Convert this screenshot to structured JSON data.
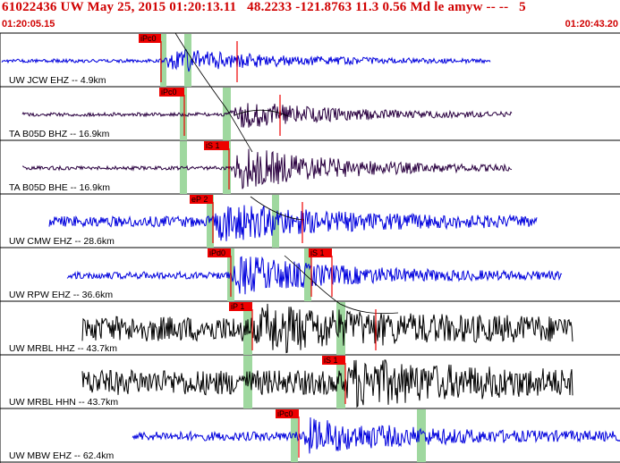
{
  "header": {
    "title": "61022436 UW May 25, 2015 01:20:13.11   48.2233 -121.8763 11.3 0.56 Md le amyw -- --   5",
    "start_time": "01:20:05.15",
    "end_time": "01:20:43.20"
  },
  "colors": {
    "header_text": "#d00000",
    "pick_box": "#ee0000",
    "window_shade": "#9fd89f",
    "trace_blue": "#0000dd",
    "trace_purple": "#2a0040",
    "trace_black": "#000000",
    "travel_time_curve": "#000000"
  },
  "traces": [
    {
      "label": "UW JCW EHZ -- 4.9km",
      "color": "trace_blue",
      "picks": [
        {
          "label": "iPc0"
        }
      ],
      "shades": 2
    },
    {
      "label": "TA B05D BHZ -- 16.9km",
      "color": "trace_purple",
      "picks": [
        {
          "label": "iPc0"
        }
      ],
      "shades": 2
    },
    {
      "label": "TA B05D BHE -- 16.9km",
      "color": "trace_purple",
      "picks": [
        {
          "label": "iS 1"
        }
      ],
      "shades": 2
    },
    {
      "label": "UW CMW EHZ -- 28.6km",
      "color": "trace_blue",
      "picks": [
        {
          "label": "eP 2"
        }
      ],
      "shades": 2
    },
    {
      "label": "UW RPW EHZ -- 36.6km",
      "color": "trace_blue",
      "picks": [
        {
          "label": "iPd0"
        },
        {
          "label": "iS 1"
        }
      ],
      "shades": 2
    },
    {
      "label": "UW MRBL HHZ -- 43.7km",
      "color": "trace_black",
      "picks": [
        {
          "label": "iP 1"
        }
      ],
      "shades": 2
    },
    {
      "label": "UW MRBL HHN -- 43.7km",
      "color": "trace_black",
      "picks": [
        {
          "label": "iS 1"
        }
      ],
      "shades": 2
    },
    {
      "label": "UW MBW EHZ -- 62.4km",
      "color": "trace_blue",
      "picks": [
        {
          "label": "iPc0"
        }
      ],
      "shades": 2
    }
  ]
}
